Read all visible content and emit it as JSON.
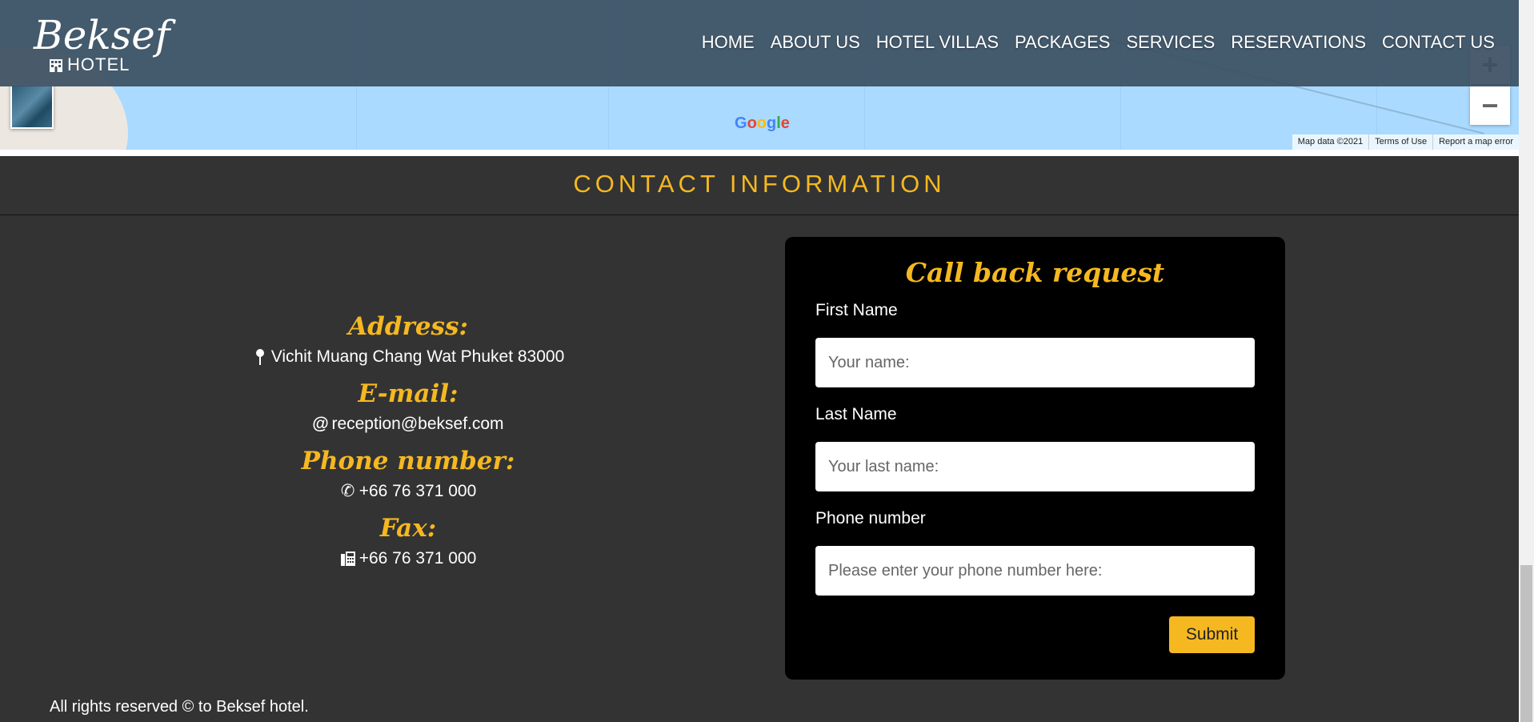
{
  "header": {
    "logo_script": "Beksef",
    "logo_sub": "HOTEL",
    "nav": [
      "HOME",
      "ABOUT US",
      "HOTEL VILLAS",
      "PACKAGES",
      "SERVICES",
      "RESERVATIONS",
      "CONTACT US"
    ]
  },
  "map": {
    "google_letters": [
      "G",
      "o",
      "o",
      "g",
      "l",
      "e"
    ],
    "zoom_in": "+",
    "zoom_out": "−",
    "attribution": [
      "Map data ©2021",
      "Terms of Use",
      "Report a map error"
    ]
  },
  "contact": {
    "title": "CONTACT INFORMATION",
    "address_label": "Address:",
    "address": "Vichit Muang Chang Wat Phuket 83000",
    "email_label": "E-mail:",
    "email": "reception@beksef.com",
    "phone_label": "Phone number:",
    "phone": "+66 76 371 000",
    "fax_label": "Fax:",
    "fax": "+66 76 371 000"
  },
  "form": {
    "title": "Call back request",
    "first_name_label": "First Name",
    "first_name_placeholder": "Your name:",
    "last_name_label": "Last Name",
    "last_name_placeholder": "Your last name:",
    "phone_label": "Phone number",
    "phone_placeholder": "Please enter your phone number here:",
    "submit": "Submit"
  },
  "footer": {
    "text": "All rights reserved © to Beksef hotel."
  },
  "colors": {
    "accent": "#f5b820",
    "background": "#333333",
    "header": "#3c5062",
    "map_water": "#aadaff"
  }
}
